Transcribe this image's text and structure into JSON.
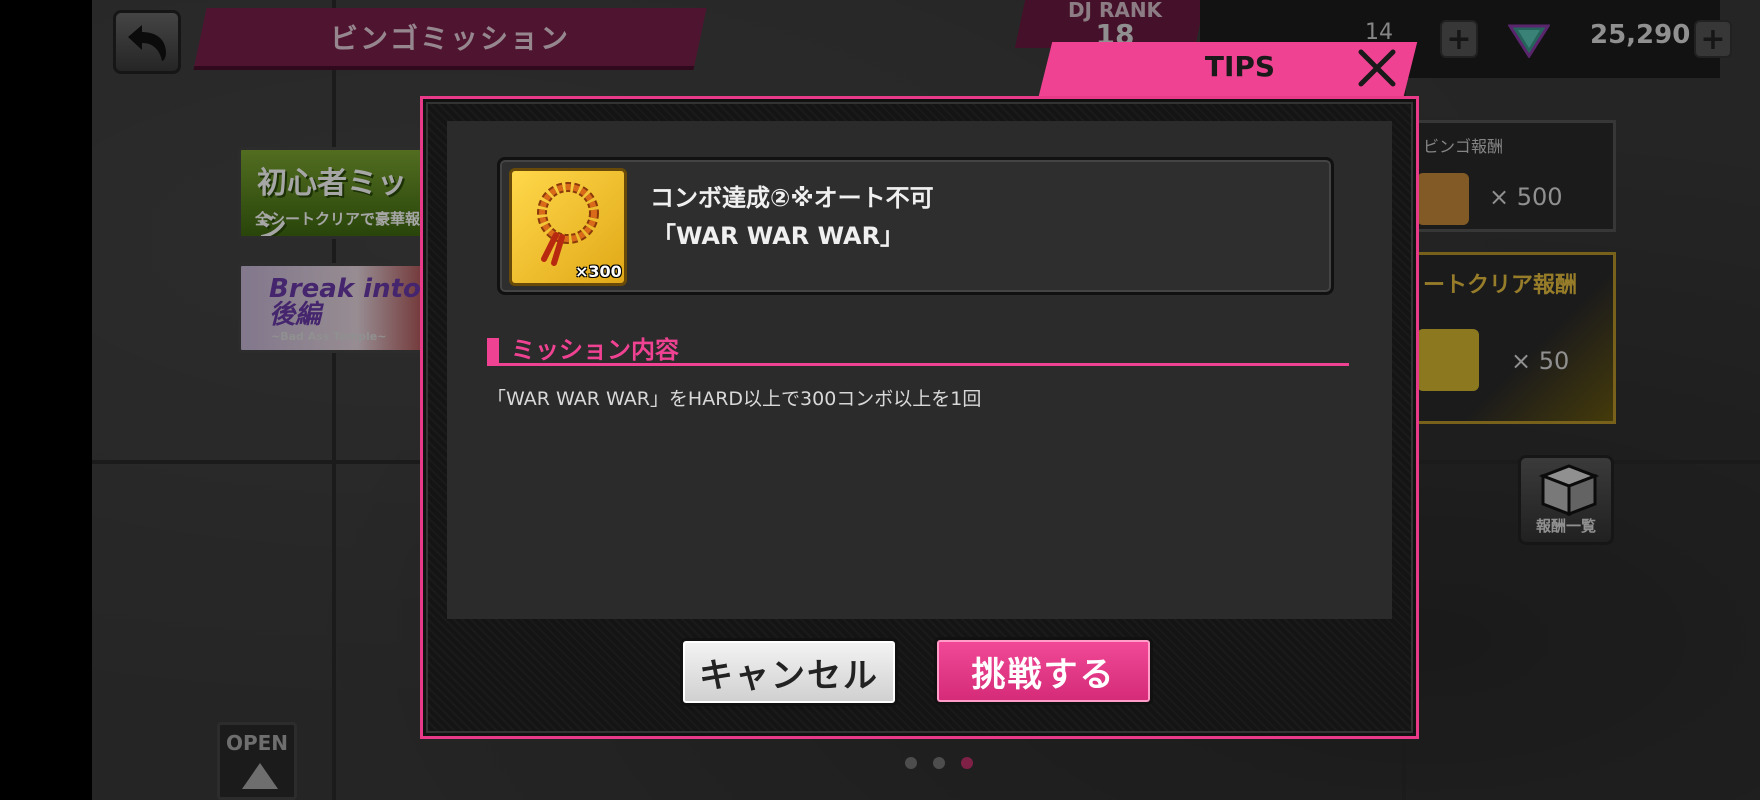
{
  "header": {
    "page_title": "ビンゴミッション",
    "dj_rank_label": "DJ RANK",
    "dj_rank_value": "18",
    "stamina_value": "14",
    "gem_count": "25,290"
  },
  "background": {
    "banners": [
      {
        "title": "初心者ミッシ",
        "subtitle": "全シートクリアで豪華報"
      },
      {
        "title": "Break into!後編",
        "subtitle": "~Bad Ass Temple~"
      }
    ],
    "bingo_reward": {
      "label": "ビンゴ報酬",
      "count": "× 500"
    },
    "sheet_reward": {
      "label": "ートクリア報酬",
      "count": "× 50"
    },
    "reward_list_label": "報酬一覧",
    "open_label": "OPEN",
    "page_dots": 3,
    "active_dot": 3
  },
  "modal": {
    "tab_title": "TIPS",
    "item": {
      "name": "コンボ達成②※オート不可",
      "song": "「WAR WAR WAR」",
      "quantity": "×300"
    },
    "section_title": "ミッション内容",
    "description": "「WAR WAR WAR」をHARD以上で300コンボ以上を1回",
    "cancel_label": "キャンセル",
    "challenge_label": "挑戦する"
  },
  "colors": {
    "accent_pink": "#f04292",
    "gold": "#e8c040"
  }
}
